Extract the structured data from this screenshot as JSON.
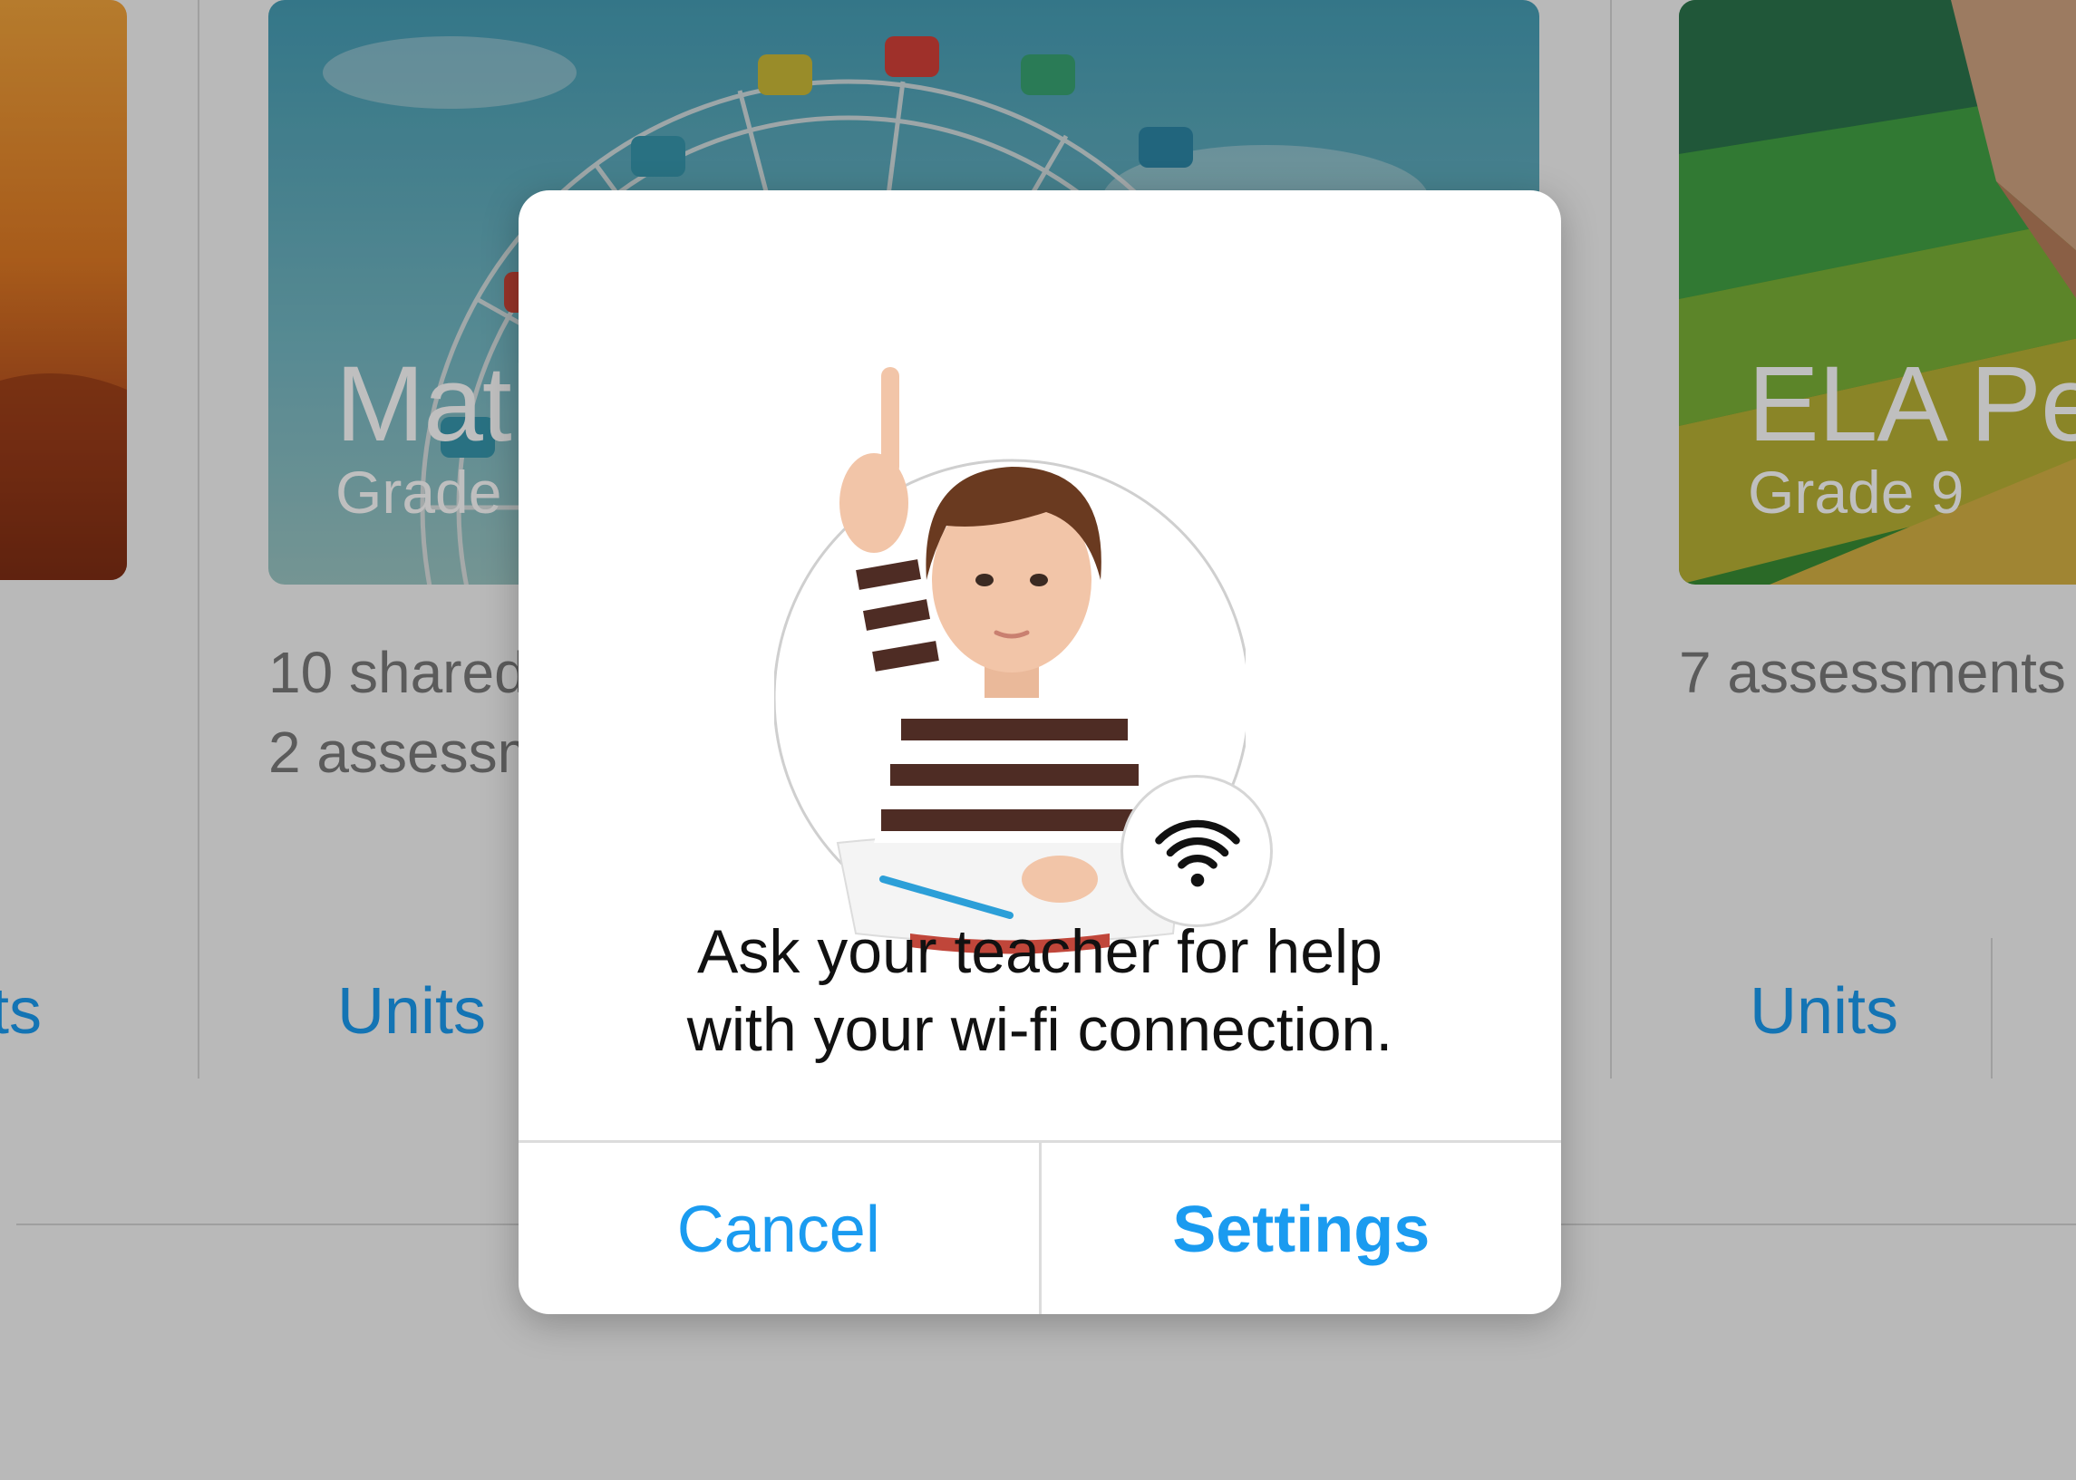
{
  "background": {
    "cards": [
      {
        "title": "Math",
        "grade": "Grade",
        "stats": [
          "10 shared",
          "2 assessm"
        ],
        "link": "Units"
      },
      {
        "title": "ELA Pe",
        "grade": "Grade 9",
        "stats": [
          "7 assessments"
        ],
        "link": "Units"
      }
    ],
    "left_card": {
      "link_fragment": "ts"
    }
  },
  "alert": {
    "message_line1": "Ask your teacher for help",
    "message_line2": "with your wi-fi connection.",
    "cancel_label": "Cancel",
    "settings_label": "Settings"
  },
  "colors": {
    "accent": "#1a9bf0",
    "dim_overlay": "rgba(0,0,0,0.25)"
  },
  "icons": {
    "wifi": "wifi-icon"
  }
}
